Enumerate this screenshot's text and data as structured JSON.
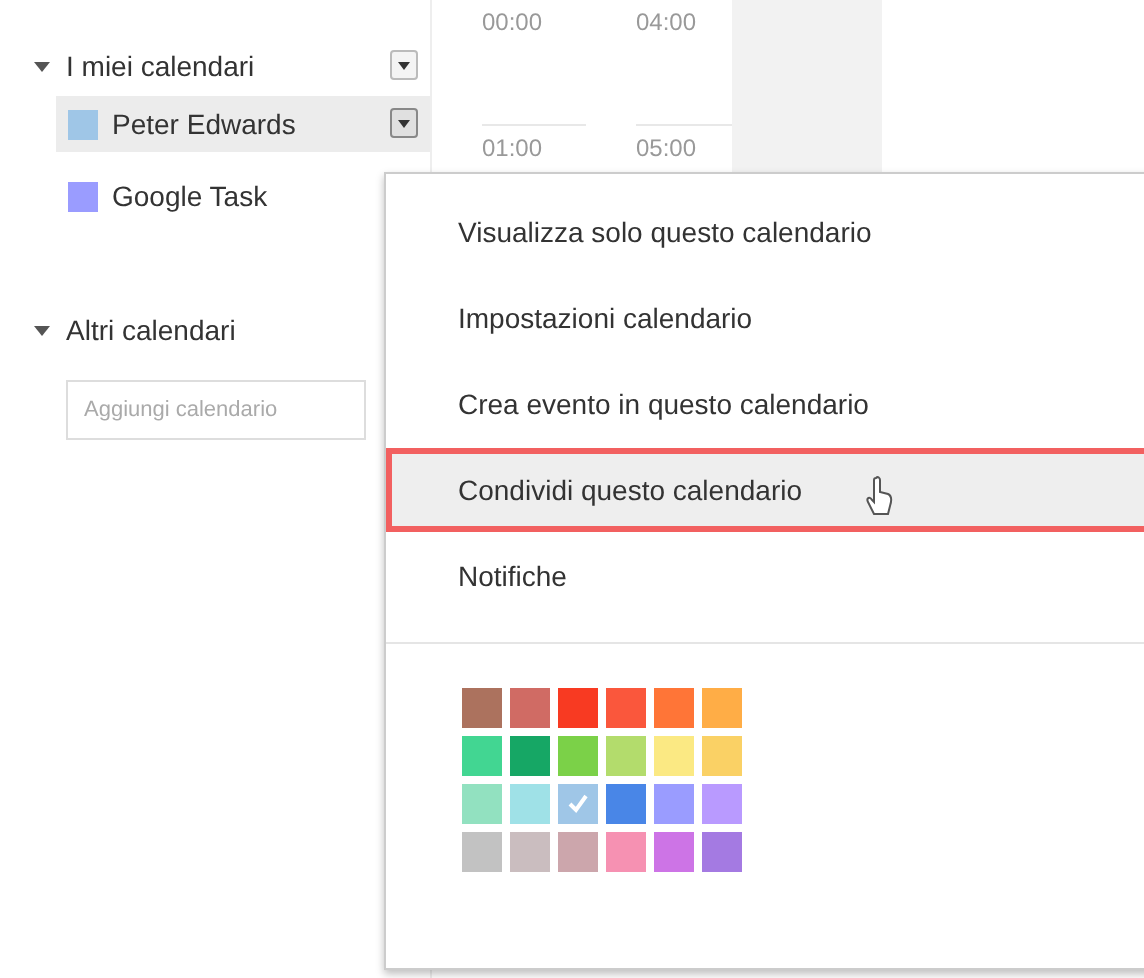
{
  "sidebar": {
    "sections": [
      {
        "title": "I miei calendari",
        "expanded": true,
        "calendars": [
          {
            "name": "Peter Edwards",
            "color": "#9fc6e7",
            "selected": true
          },
          {
            "name": "Google Task",
            "color": "#9a9cff",
            "selected": false
          }
        ]
      },
      {
        "title": "Altri calendari",
        "expanded": true,
        "placeholder": "Aggiungi calendario"
      }
    ]
  },
  "time_grid": {
    "columns": [
      [
        "00:00",
        "01:00"
      ],
      [
        "04:00",
        "05:00"
      ]
    ]
  },
  "menu": {
    "items": [
      {
        "label": "Visualizza solo questo calendario",
        "selected": false
      },
      {
        "label": "Impostazioni calendario",
        "selected": false
      },
      {
        "label": "Crea evento in questo calendario",
        "selected": false
      },
      {
        "label": "Condividi questo calendario",
        "selected": true
      },
      {
        "label": "Notifiche",
        "selected": false
      }
    ],
    "palette": [
      {
        "color": "#ac725e",
        "selected": false
      },
      {
        "color": "#d06b64",
        "selected": false
      },
      {
        "color": "#f83a22",
        "selected": false
      },
      {
        "color": "#fa573c",
        "selected": false
      },
      {
        "color": "#ff7537",
        "selected": false
      },
      {
        "color": "#ffad46",
        "selected": false
      },
      {
        "color": "#42d692",
        "selected": false
      },
      {
        "color": "#16a765",
        "selected": false
      },
      {
        "color": "#7bd148",
        "selected": false
      },
      {
        "color": "#b3dc6c",
        "selected": false
      },
      {
        "color": "#fbe983",
        "selected": false
      },
      {
        "color": "#fad165",
        "selected": false
      },
      {
        "color": "#92e1c0",
        "selected": false
      },
      {
        "color": "#9fe1e7",
        "selected": false
      },
      {
        "color": "#9fc6e7",
        "selected": true
      },
      {
        "color": "#4986e7",
        "selected": false
      },
      {
        "color": "#9a9cff",
        "selected": false
      },
      {
        "color": "#b99aff",
        "selected": false
      },
      {
        "color": "#c2c2c2",
        "selected": false
      },
      {
        "color": "#cabdbf",
        "selected": false
      },
      {
        "color": "#cca6ac",
        "selected": false
      },
      {
        "color": "#f691b2",
        "selected": false
      },
      {
        "color": "#cd74e6",
        "selected": false
      },
      {
        "color": "#a47ae2",
        "selected": false
      }
    ]
  }
}
